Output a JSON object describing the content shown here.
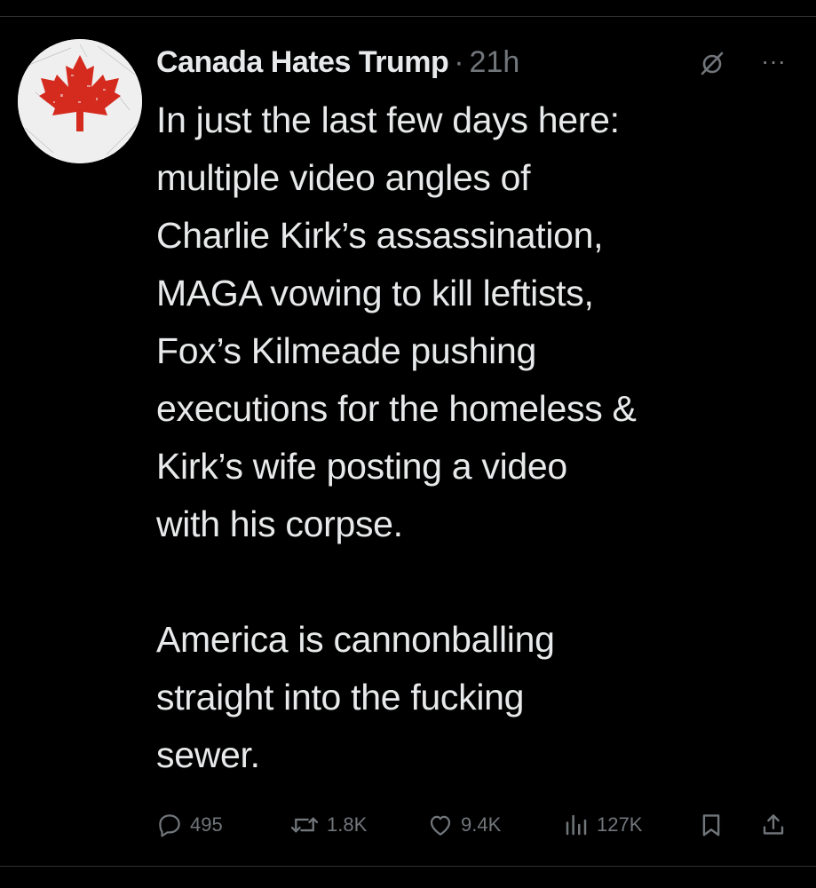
{
  "tweet": {
    "author": {
      "display_name": "Canada Hates Trump",
      "avatar_icon": "maple-leaf-icon",
      "avatar_color": "#d52b1e"
    },
    "separator": "·",
    "timestamp": "21h",
    "paragraphs": [
      "In just the last few days here:\nmultiple video angles of\nCharlie Kirk’s assassination,\nMAGA vowing to kill leftists,\nFox’s Kilmeade pushing\nexecutions for the homeless &\nKirk’s wife posting a video\nwith his corpse.",
      "America is cannonballing\nstraight into the fucking\nsewer."
    ]
  },
  "header_icons": {
    "grok": "grok-icon",
    "more": "more-icon",
    "more_glyph": "···"
  },
  "actions": {
    "reply": {
      "icon": "reply-icon",
      "count": "495"
    },
    "repost": {
      "icon": "repost-icon",
      "count": "1.8K"
    },
    "like": {
      "icon": "heart-icon",
      "count": "9.4K"
    },
    "views": {
      "icon": "views-icon",
      "count": "127K"
    },
    "bookmark": {
      "icon": "bookmark-icon"
    },
    "share": {
      "icon": "share-icon"
    }
  },
  "colors": {
    "background": "#000000",
    "text": "#e7e9ea",
    "secondary": "#71767b",
    "divider": "#2f3336"
  }
}
